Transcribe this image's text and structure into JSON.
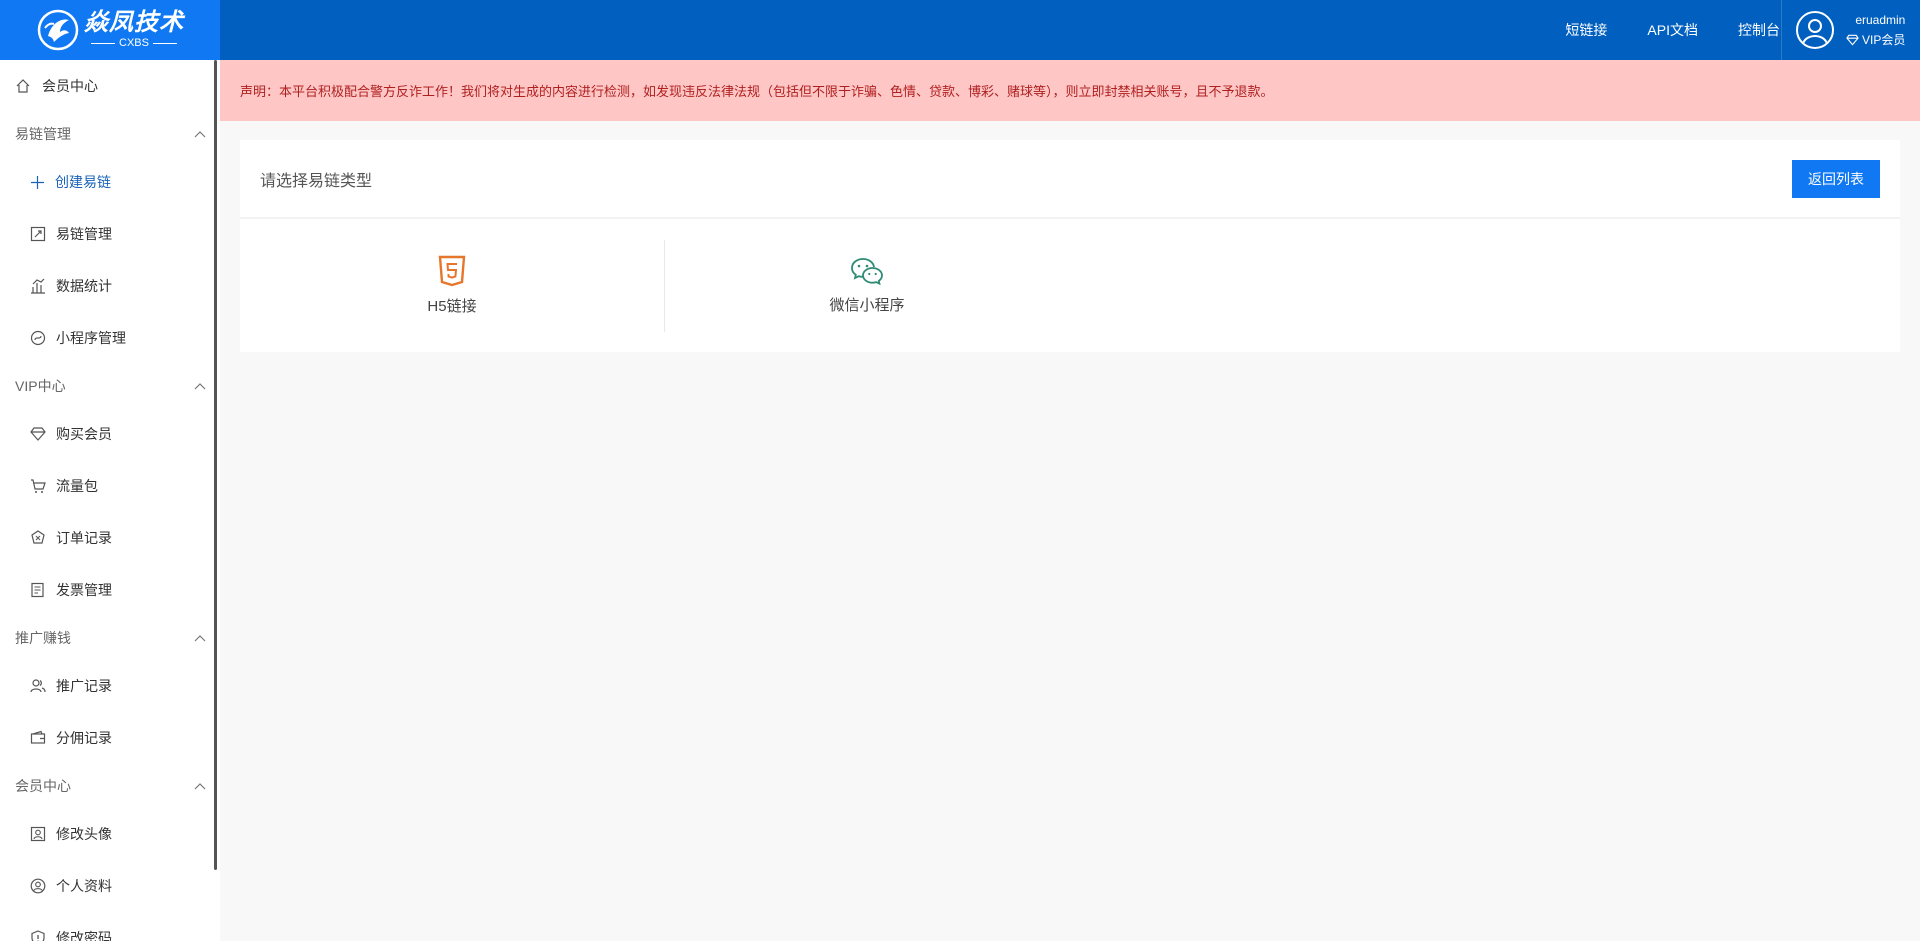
{
  "header": {
    "logo_title": "焱凤技术",
    "logo_sub": "CXBS",
    "nav": [
      "短链接",
      "API文档",
      "控制台"
    ],
    "username": "eruadmin",
    "vip_label": "VIP会员"
  },
  "sidebar": {
    "home": "会员中心",
    "groups": [
      {
        "label": "易链管理",
        "items": [
          "创建易链",
          "易链管理",
          "数据统计",
          "小程序管理"
        ]
      },
      {
        "label": "VIP中心",
        "items": [
          "购买会员",
          "流量包",
          "订单记录",
          "发票管理"
        ]
      },
      {
        "label": "推广赚钱",
        "items": [
          "推广记录",
          "分佣记录"
        ]
      },
      {
        "label": "会员中心",
        "items": [
          "修改头像",
          "个人资料",
          "修改密码"
        ]
      }
    ]
  },
  "notice": "声明：本平台积极配合警方反诈工作！我们将对生成的内容进行检测，如发现违反法律法规（包括但不限于诈骗、色情、贷款、博彩、赌球等），则立即封禁相关账号，且不予退款。",
  "main": {
    "title": "请选择易链类型",
    "back_button": "返回列表",
    "types": [
      "H5链接",
      "微信小程序"
    ]
  },
  "colors": {
    "header_bg": "#005fbf",
    "logo_bg": "#0f78f2",
    "button_bg": "#0f78f2",
    "notice_bg": "#fec7c6",
    "notice_text": "#b01f1f",
    "active_text": "#1a63b8",
    "h5_icon": "#e6762b",
    "wechat_icon": "#2e8b74"
  },
  "icons": {
    "sidebar": [
      "home-icon",
      "plus-icon",
      "link-icon",
      "bar-chart-icon",
      "miniprogram-icon",
      "diamond-icon",
      "cart-icon",
      "order-icon",
      "invoice-icon",
      "users-icon",
      "wallet-icon",
      "picture-icon",
      "user-icon",
      "shield-icon"
    ],
    "types": [
      "html5-icon",
      "wechat-icon"
    ]
  }
}
